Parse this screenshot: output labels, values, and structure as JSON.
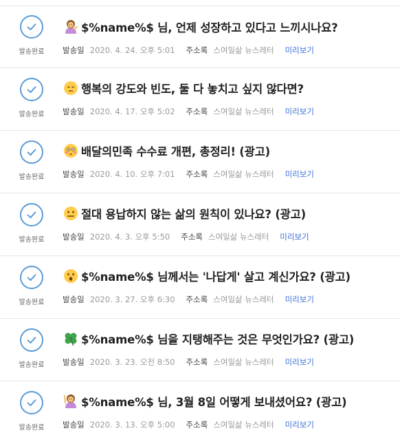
{
  "status_label": "발송완료",
  "date_key": "발송일",
  "address_key": "주소록",
  "preview_label": "미리보기",
  "colors": {
    "check": "#5b9bd5",
    "link": "#3a6fd8",
    "divider": "#e6e6e6"
  },
  "items": [
    {
      "icon": "woman-tipping-hand-emoji",
      "subject": "$%name%$ 님, 언제 성장하고 있다고 느끼시나요?",
      "date": "2020. 4. 24. 오후 5:01",
      "address": "스여일삶 뉴스레터"
    },
    {
      "icon": "pensive-face-emoji",
      "subject": "행복의 강도와 빈도, 둘 다 놓치고 싶지 않다면?",
      "date": "2020. 4. 17. 오후 5:02",
      "address": "스여일삶 뉴스레터"
    },
    {
      "icon": "flushed-face-emoji",
      "subject": "배달의민족 수수료 개편, 총정리! (광고)",
      "date": "2020. 4. 10. 오후 7:01",
      "address": "스여일삶 뉴스레터"
    },
    {
      "icon": "neutral-face-emoji",
      "subject": "절대 용납하지 않는 삶의 원칙이 있나요? (광고)",
      "date": "2020. 4. 3. 오후 5:50",
      "address": "스여일삶 뉴스레터"
    },
    {
      "icon": "surprised-face-emoji",
      "subject": "$%name%$ 님께서는 '나답게' 살고 계신가요? (광고)",
      "date": "2020. 3. 27. 오후 6:30",
      "address": "스여일삶 뉴스레터"
    },
    {
      "icon": "four-leaf-clover-emoji",
      "subject": "$%name%$ 님을 지탱해주는 것은 무엇인가요? (광고)",
      "date": "2020. 3. 23. 오전 8:50",
      "address": "스여일삶 뉴스레터"
    },
    {
      "icon": "woman-raising-hand-emoji",
      "subject": "$%name%$ 님, 3월 8일 어떻게 보내셨어요? (광고)",
      "date": "2020. 3. 13. 오후 5:00",
      "address": "스여일삶 뉴스레터"
    }
  ]
}
